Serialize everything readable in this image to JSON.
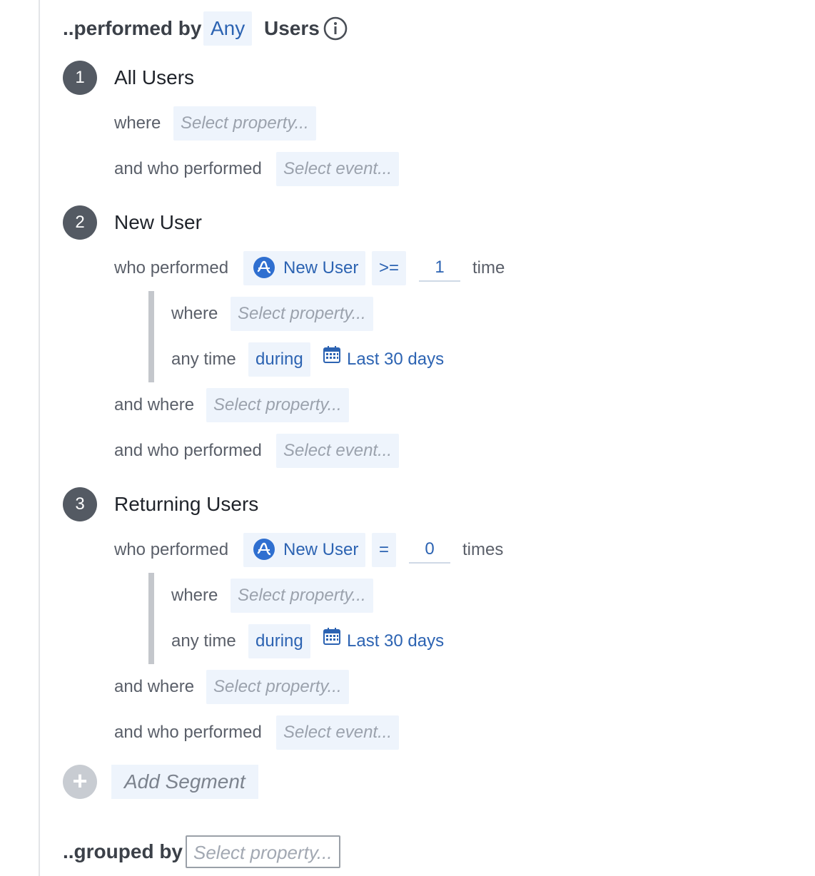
{
  "header": {
    "prefix": "..performed by",
    "scope_value": "Any",
    "users_label": "Users"
  },
  "segments": [
    {
      "number": "1",
      "name": "All Users",
      "where_label": "where",
      "where_placeholder": "Select property...",
      "and_who_performed_label": "and who performed",
      "event_placeholder": "Select event..."
    },
    {
      "number": "2",
      "name": "New User",
      "who_performed_label": "who performed",
      "event_name": "New User",
      "operator": ">=",
      "count": "1",
      "count_unit": "time",
      "inner_where_label": "where",
      "inner_where_placeholder": "Select property...",
      "any_time_label": "any time",
      "during_label": "during",
      "date_range": "Last 30 days",
      "and_where_label": "and where",
      "and_where_placeholder": "Select property...",
      "and_who_performed_label": "and who performed",
      "event_placeholder": "Select event..."
    },
    {
      "number": "3",
      "name": "Returning Users",
      "who_performed_label": "who performed",
      "event_name": "New User",
      "operator": "=",
      "count": "0",
      "count_unit": "times",
      "inner_where_label": "where",
      "inner_where_placeholder": "Select property...",
      "any_time_label": "any time",
      "during_label": "during",
      "date_range": "Last 30 days",
      "and_where_label": "and where",
      "and_where_placeholder": "Select property...",
      "and_who_performed_label": "and who performed",
      "event_placeholder": "Select event..."
    }
  ],
  "add_segment": {
    "icon": "+",
    "label": "Add Segment"
  },
  "grouped_by": {
    "label": "..grouped by",
    "placeholder": "Select property..."
  },
  "colors": {
    "accent": "#2c63b2",
    "pill_bg": "#eef4fc",
    "badge": "#545a63",
    "event_icon": "#2f6fd0"
  }
}
